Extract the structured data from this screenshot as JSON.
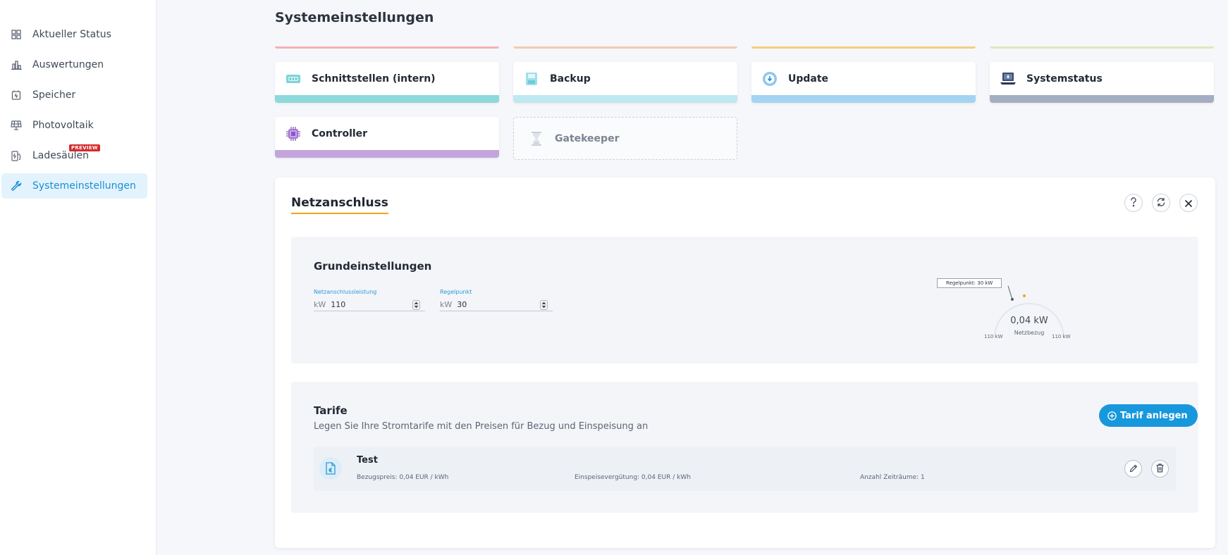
{
  "sidebar": {
    "items": [
      {
        "label": "Aktueller Status",
        "icon": "grid-icon"
      },
      {
        "label": "Auswertungen",
        "icon": "bar-chart-icon"
      },
      {
        "label": "Speicher",
        "icon": "battery-icon"
      },
      {
        "label": "Photovoltaik",
        "icon": "solar-panel-icon"
      },
      {
        "label": "Ladesäulen",
        "icon": "charging-station-icon",
        "badge": "PREVIEW"
      },
      {
        "label": "Systemeinstellungen",
        "icon": "wrench-icon",
        "active": true
      }
    ]
  },
  "page": {
    "title": "Systemeinstellungen"
  },
  "tiles": [
    {
      "label": "Schnittstellen (intern)",
      "icon": "interface-icon",
      "color": "#8dd9dc"
    },
    {
      "label": "Backup",
      "icon": "backup-icon",
      "color": "#bfe8f1"
    },
    {
      "label": "Update",
      "icon": "update-icon",
      "color": "#a5d3f2"
    },
    {
      "label": "Systemstatus",
      "icon": "laptop-status-icon",
      "color": "#a4aec2"
    },
    {
      "label": "Controller",
      "icon": "chip-icon",
      "color": "#c3a5dd"
    },
    {
      "label": "Gatekeeper",
      "icon": "hourglass-icon",
      "disabled": true
    }
  ],
  "colors": {
    "accent": "#1797dc",
    "title_underline": "#f2a516",
    "gauge_dot": "#f2a516"
  },
  "panel": {
    "title": "Netzanschluss",
    "grund": {
      "title": "Grundeinstellungen",
      "fields": [
        {
          "label": "Netzanschlussleistung",
          "unit": "kW",
          "value": "110"
        },
        {
          "label": "Regelpunkt",
          "unit": "kW",
          "value": "30"
        }
      ],
      "gauge": {
        "tooltip": "Regelpunkt: 30 kW",
        "value": "0,04 kW",
        "sublabel": "Netzbezug",
        "min_label": "110 kW",
        "max_label": "110 kW"
      }
    },
    "tarife": {
      "title": "Tarife",
      "subtitle": "Legen Sie Ihre Stromtarife mit den Preisen für Bezug und Einspeisung an",
      "add_button": "Tarif anlegen",
      "items": [
        {
          "name": "Test",
          "bezug": "Bezugspreis: 0,04 EUR / kWh",
          "einspeisung": "Einspeisevergütung: 0,04 EUR / kWh",
          "zeitraeume": "Anzahl Zeiträume: 1"
        }
      ]
    }
  }
}
